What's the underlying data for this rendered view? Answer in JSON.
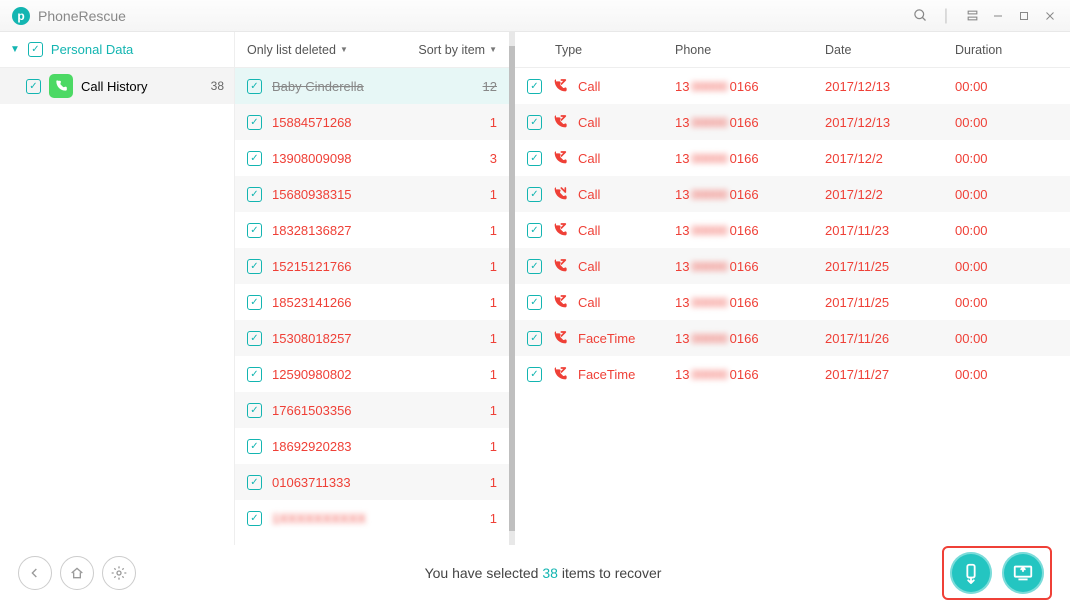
{
  "app_title": "PhoneRescue",
  "sidebar": {
    "personal_label": "Personal Data",
    "category_label": "Call History",
    "category_count": "38"
  },
  "mid": {
    "filter_label": "Only list deleted",
    "sort_label": "Sort by item",
    "rows": [
      {
        "name": "Baby Cinderella",
        "count": "12",
        "sel": true
      },
      {
        "name": "15884571268",
        "count": "1"
      },
      {
        "name": "13908009098",
        "count": "3"
      },
      {
        "name": "15680938315",
        "count": "1"
      },
      {
        "name": "18328136827",
        "count": "1"
      },
      {
        "name": "15215121766",
        "count": "1"
      },
      {
        "name": "18523141266",
        "count": "1"
      },
      {
        "name": "15308018257",
        "count": "1"
      },
      {
        "name": "12590980802",
        "count": "1"
      },
      {
        "name": "17661503356",
        "count": "1"
      },
      {
        "name": "18692920283",
        "count": "1"
      },
      {
        "name": "01063711333",
        "count": "1"
      },
      {
        "name": "1XXXXXXXXXX",
        "count": "1",
        "blur": true
      }
    ]
  },
  "main": {
    "headers": {
      "type": "Type",
      "phone": "Phone",
      "date": "Date",
      "duration": "Duration"
    },
    "rows": [
      {
        "type": "Call",
        "icon": "out",
        "pre": "13",
        "suf": "0166",
        "date": "2017/12/13",
        "dur": "00:00"
      },
      {
        "type": "Call",
        "icon": "out",
        "pre": "13",
        "suf": "0166",
        "date": "2017/12/13",
        "dur": "00:00"
      },
      {
        "type": "Call",
        "icon": "out",
        "pre": "13",
        "suf": "0166",
        "date": "2017/12/2",
        "dur": "00:00"
      },
      {
        "type": "Call",
        "icon": "missed",
        "pre": "13",
        "suf": "0166",
        "date": "2017/12/2",
        "dur": "00:00"
      },
      {
        "type": "Call",
        "icon": "out",
        "pre": "13",
        "suf": "0166",
        "date": "2017/11/23",
        "dur": "00:00"
      },
      {
        "type": "Call",
        "icon": "out",
        "pre": "13",
        "suf": "0166",
        "date": "2017/11/25",
        "dur": "00:00"
      },
      {
        "type": "Call",
        "icon": "out",
        "pre": "13",
        "suf": "0166",
        "date": "2017/11/25",
        "dur": "00:00"
      },
      {
        "type": "FaceTime",
        "icon": "out",
        "pre": "13",
        "suf": "0166",
        "date": "2017/11/26",
        "dur": "00:00"
      },
      {
        "type": "FaceTime",
        "icon": "out",
        "pre": "13",
        "suf": "0166",
        "date": "2017/11/27",
        "dur": "00:00"
      }
    ]
  },
  "footer": {
    "pre": "You have selected ",
    "count": "38",
    "post": " items to recover"
  }
}
